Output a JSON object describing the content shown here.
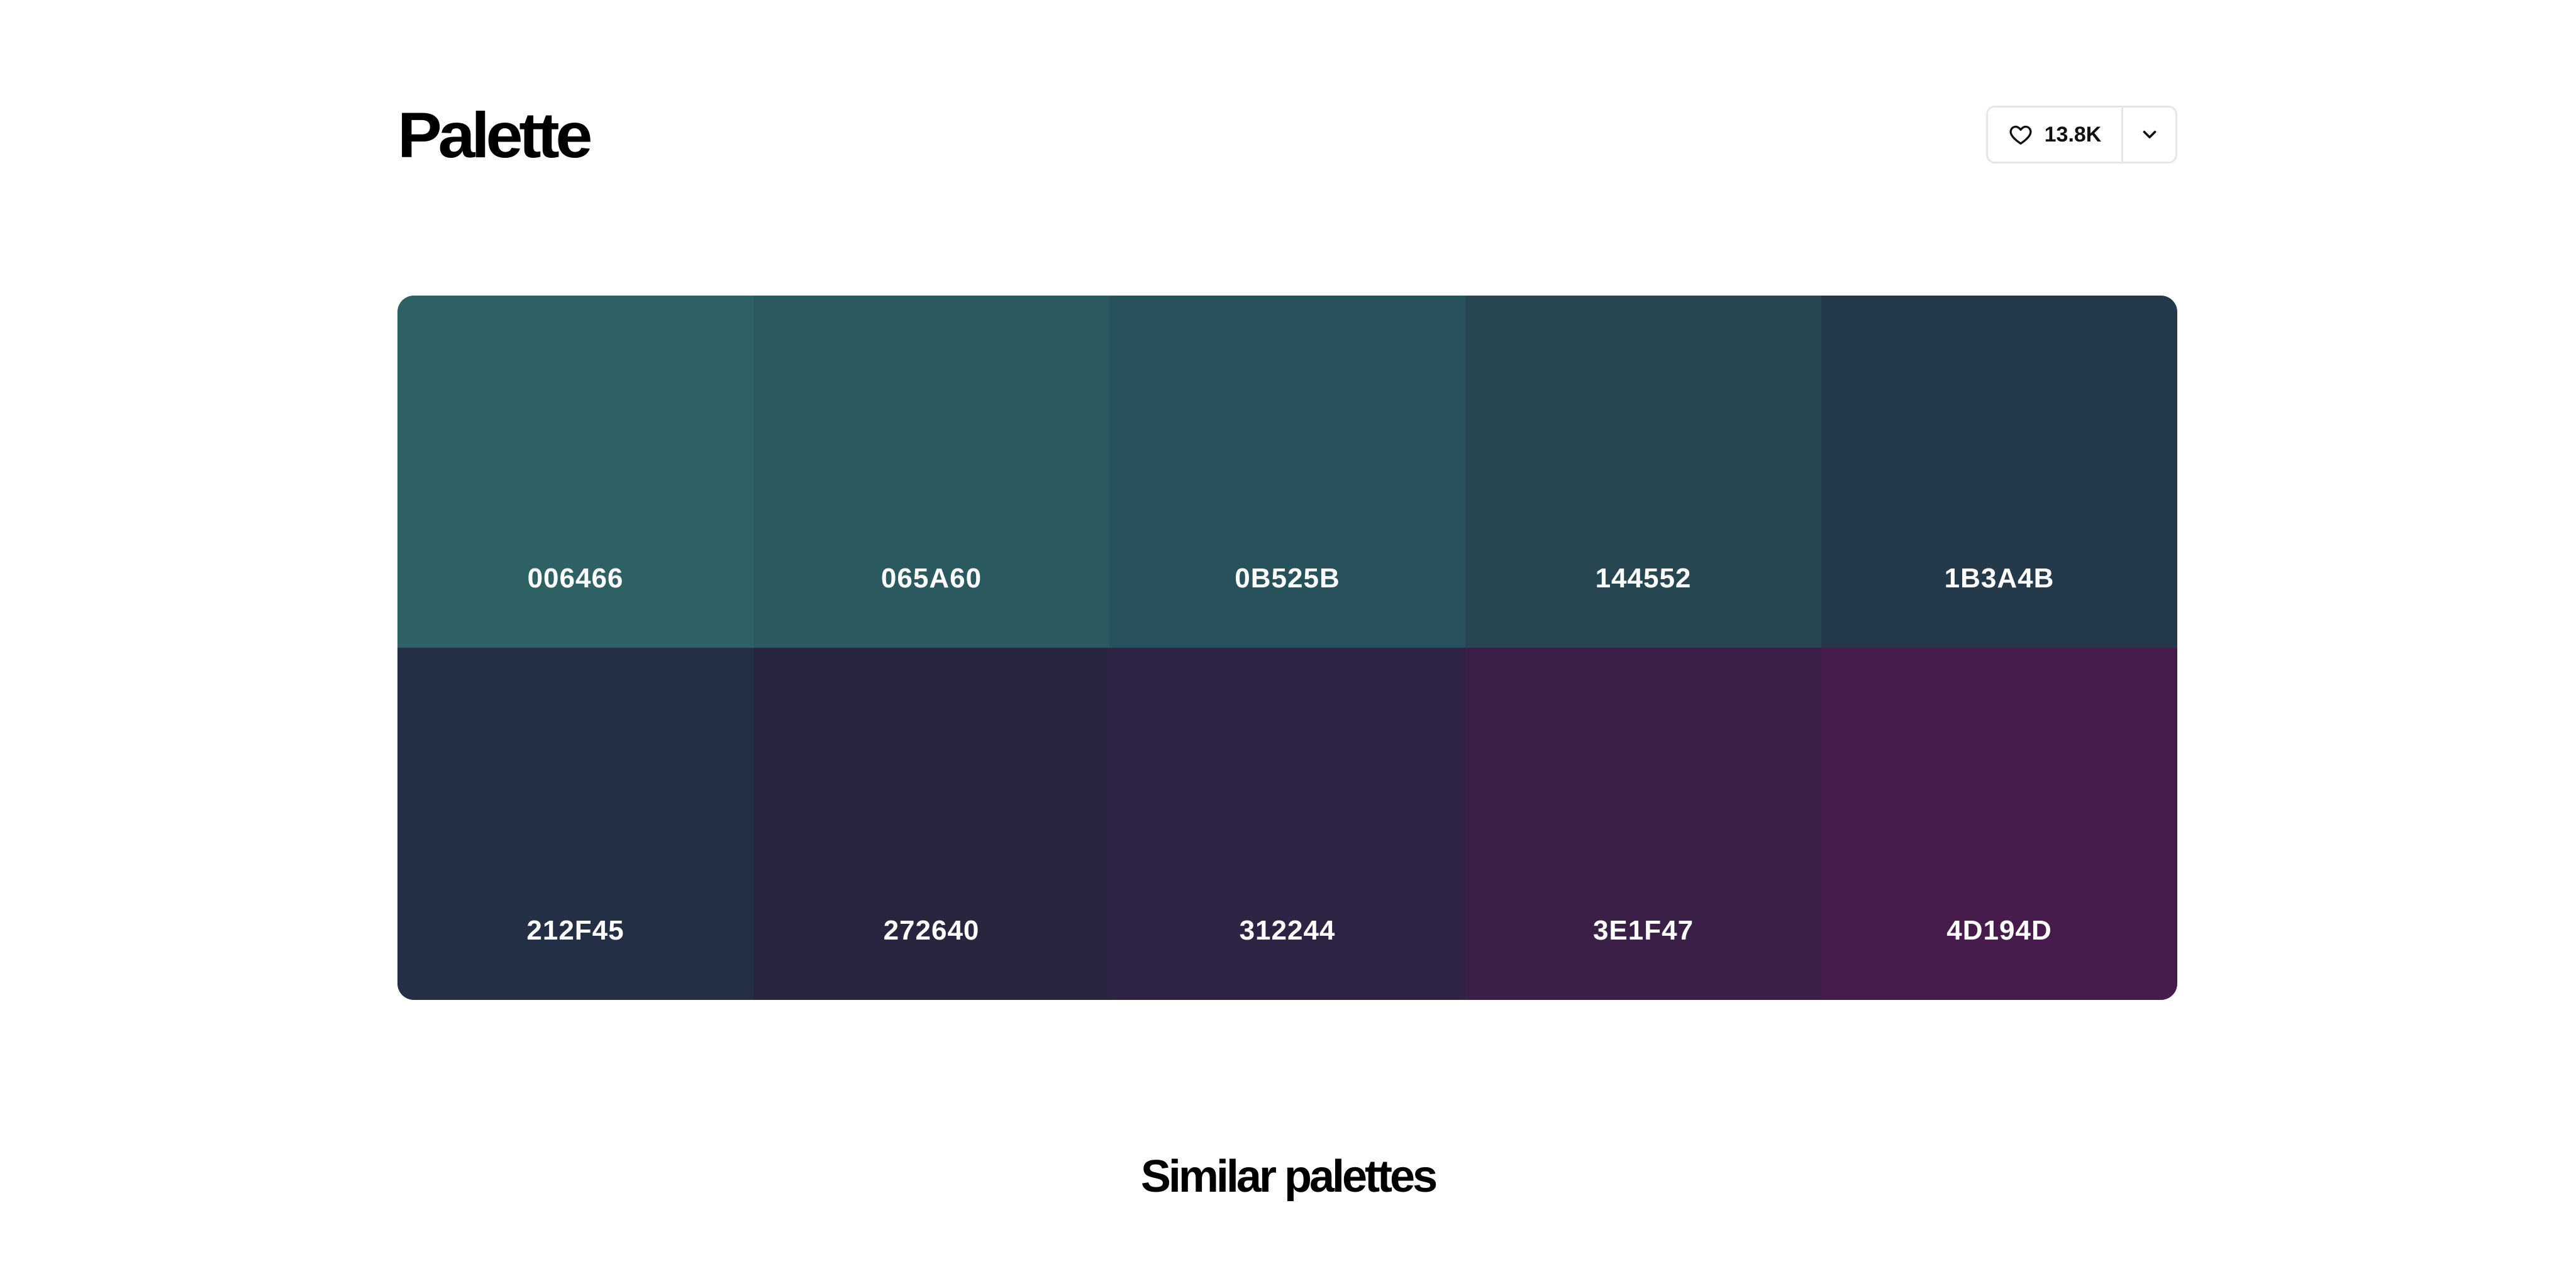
{
  "header": {
    "title": "Palette",
    "like_count": "13.8K",
    "like_icon": "heart-icon",
    "dropdown_icon": "chevron-down-icon"
  },
  "palette": {
    "swatches": [
      {
        "hex": "006466",
        "color": "#2D6164"
      },
      {
        "hex": "065A60",
        "color": "#2A5960"
      },
      {
        "hex": "0B525B",
        "color": "#27525B"
      },
      {
        "hex": "144552",
        "color": "#264651"
      },
      {
        "hex": "1B3A4B",
        "color": "#24394A"
      },
      {
        "hex": "212F45",
        "color": "#232F44"
      },
      {
        "hex": "272640",
        "color": "#27263E"
      },
      {
        "hex": "312244",
        "color": "#2F2343"
      },
      {
        "hex": "3E1F47",
        "color": "#3A2047"
      },
      {
        "hex": "4D194D",
        "color": "#471C4C"
      }
    ]
  },
  "similar": {
    "title": "Similar palettes"
  }
}
